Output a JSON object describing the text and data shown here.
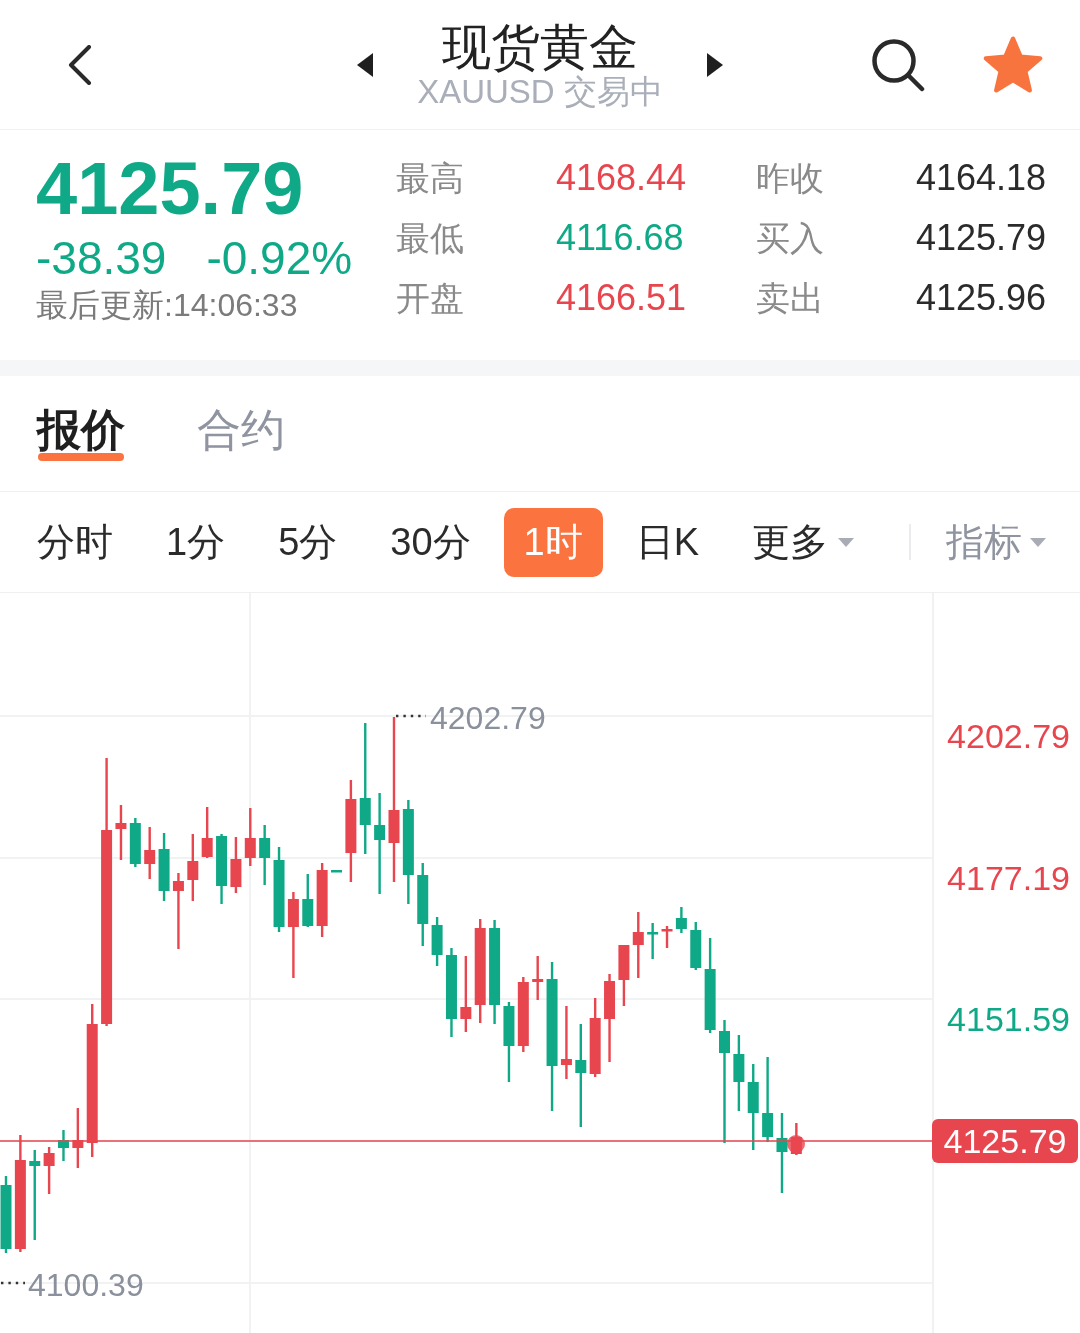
{
  "header": {
    "title": "现货黄金",
    "subtitle": "XAUUSD 交易中",
    "favorited": true
  },
  "quote": {
    "price": "4125.79",
    "change": "-38.39",
    "change_percent": "-0.92%",
    "updated": "最后更新:14:06:33"
  },
  "stats": [
    {
      "label": "最高",
      "value": "4168.44",
      "color": "#e8464f"
    },
    {
      "label": "昨收",
      "value": "4164.18",
      "color": "#2b2b2b"
    },
    {
      "label": "最低",
      "value": "4116.68",
      "color": "#10a987"
    },
    {
      "label": "买入",
      "value": "4125.79",
      "color": "#2b2b2b"
    },
    {
      "label": "开盘",
      "value": "4166.51",
      "color": "#e8464f"
    },
    {
      "label": "卖出",
      "value": "4125.96",
      "color": "#2b2b2b"
    }
  ],
  "tabs": [
    {
      "label": "报价",
      "selected": true
    },
    {
      "label": "合约",
      "selected": false
    }
  ],
  "periods": [
    {
      "label": "分时",
      "selected": false,
      "menu": false
    },
    {
      "label": "1分",
      "selected": false,
      "menu": false
    },
    {
      "label": "5分",
      "selected": false,
      "menu": false
    },
    {
      "label": "30分",
      "selected": false,
      "menu": false
    },
    {
      "label": "1时",
      "selected": true,
      "menu": false
    },
    {
      "label": "日K",
      "selected": false,
      "menu": false
    },
    {
      "label": "更多",
      "selected": false,
      "menu": true
    }
  ],
  "indicator": {
    "label": "指标",
    "menu": true
  },
  "chart": {
    "axis_labels": [
      {
        "text": "4202.79",
        "color": "#e8464f"
      },
      {
        "text": "4177.19",
        "color": "#e8464f"
      },
      {
        "text": "4151.59",
        "color": "#10a987"
      }
    ],
    "high_label": "4202.79",
    "low_label": "4100.39",
    "last_price": "4125.79"
  }
}
